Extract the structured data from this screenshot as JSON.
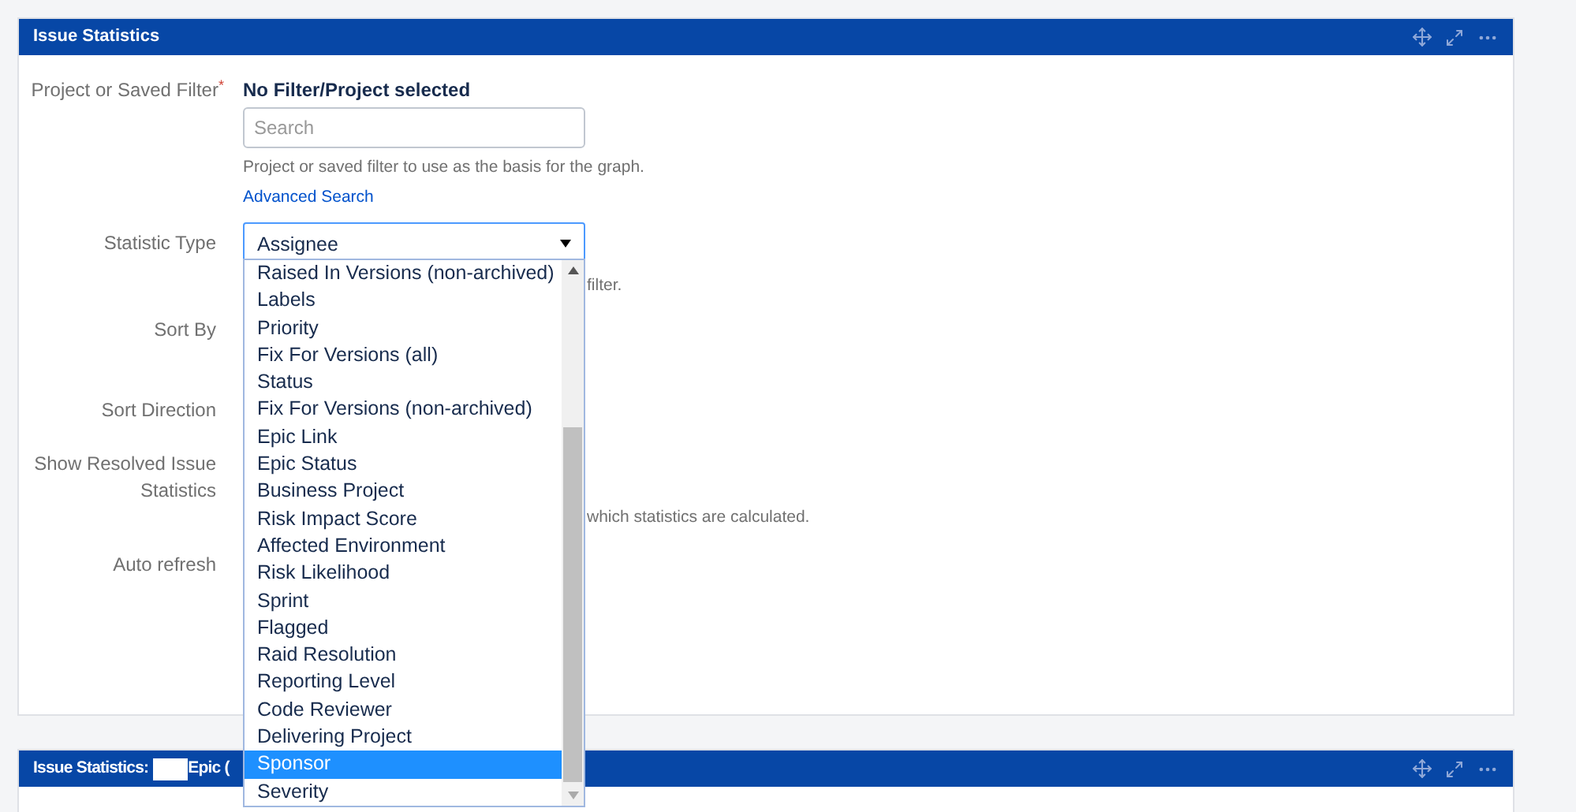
{
  "gadget": {
    "title": "Issue Statistics",
    "project_filter": {
      "label": "Project or Saved Filter",
      "required_mark": "*",
      "selection": "No Filter/Project selected",
      "placeholder": "Search",
      "help": "Project or saved filter to use as the basis for the graph.",
      "link": "Advanced Search"
    },
    "statistic_type": {
      "label": "Statistic Type",
      "value": "Assignee",
      "help_tail": "filter."
    },
    "sort_by": {
      "label": "Sort By"
    },
    "sort_direction": {
      "label": "Sort Direction"
    },
    "show_resolved": {
      "label": "Show Resolved Issue Statistics",
      "help_tail": "which statistics are calculated."
    },
    "auto_refresh": {
      "label": "Auto refresh"
    }
  },
  "dropdown": {
    "options": [
      {
        "label": "Raised In Versions (non-archived)",
        "selected": false
      },
      {
        "label": "Labels",
        "selected": false
      },
      {
        "label": "Priority",
        "selected": false
      },
      {
        "label": "Fix For Versions (all)",
        "selected": false
      },
      {
        "label": "Status",
        "selected": false
      },
      {
        "label": "Fix For Versions (non-archived)",
        "selected": false
      },
      {
        "label": "Epic Link",
        "selected": false
      },
      {
        "label": "Epic Status",
        "selected": false
      },
      {
        "label": "Business Project",
        "selected": false
      },
      {
        "label": "Risk Impact Score",
        "selected": false
      },
      {
        "label": "Affected Environment",
        "selected": false
      },
      {
        "label": "Risk Likelihood",
        "selected": false
      },
      {
        "label": "Sprint",
        "selected": false
      },
      {
        "label": "Flagged",
        "selected": false
      },
      {
        "label": "Raid Resolution",
        "selected": false
      },
      {
        "label": "Reporting Level",
        "selected": false
      },
      {
        "label": "Code Reviewer",
        "selected": false
      },
      {
        "label": "Delivering Project",
        "selected": false
      },
      {
        "label": "Sponsor",
        "selected": true
      },
      {
        "label": "Severity",
        "selected": false
      }
    ]
  },
  "second_gadget": {
    "title_start": "Issue Statistics:",
    "title_end": "Epic ("
  }
}
